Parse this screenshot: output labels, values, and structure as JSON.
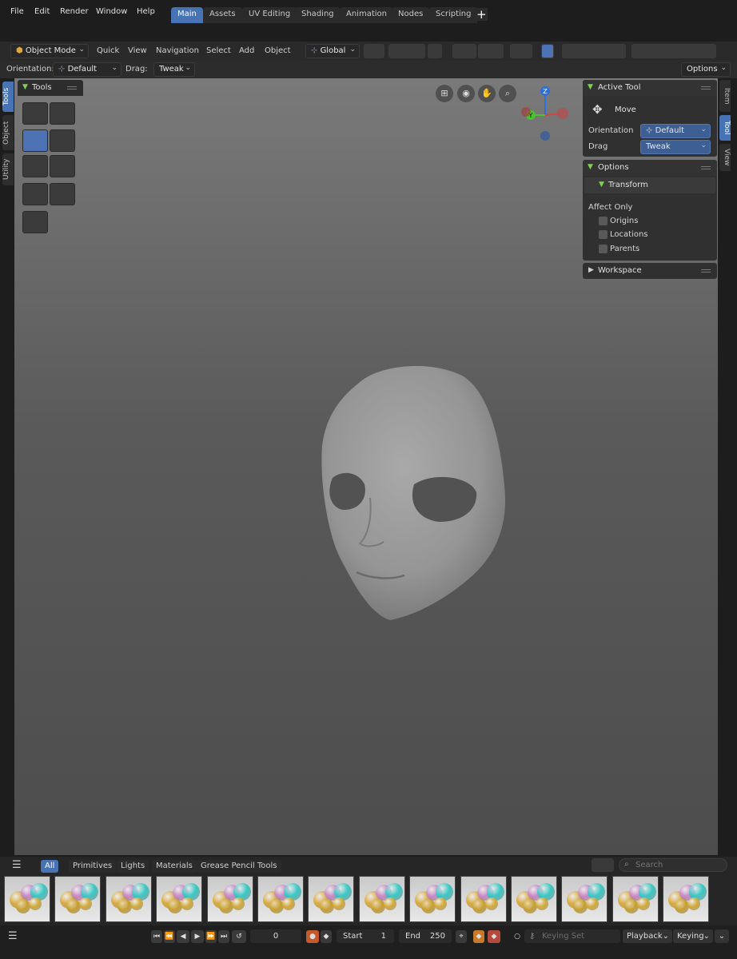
{
  "menu": [
    "File",
    "Edit",
    "Render",
    "Window",
    "Help"
  ],
  "workspaces": [
    "Main",
    "Assets",
    "UV Editing",
    "Shading",
    "Animation",
    "Nodes",
    "Scripting"
  ],
  "add_workspace": "+",
  "header": {
    "mode": "Object Mode",
    "menus": [
      "Quick",
      "View",
      "Navigation",
      "Select",
      "Add",
      "Object"
    ],
    "transform_orientation": "Global",
    "options": "Options"
  },
  "tool_settings": {
    "orientation_label": "Orientation:",
    "orientation_value": "Default",
    "drag_label": "Drag:",
    "drag_value": "Tweak"
  },
  "left_tabs": [
    "Tools",
    "Object",
    "Utility"
  ],
  "right_tabs": [
    "Item",
    "Tool",
    "View"
  ],
  "tools_panel": {
    "title": "Tools"
  },
  "gizmo": {
    "z": "Z",
    "y": "Y"
  },
  "active_tool_panel": {
    "title": "Active Tool",
    "tool_name": "Move",
    "orientation_label": "Orientation",
    "orientation_value": "Default",
    "drag_label": "Drag",
    "drag_value": "Tweak"
  },
  "options_panel": {
    "title": "Options",
    "transform_label": "Transform",
    "affect_only_label": "Affect Only",
    "checkboxes": [
      "Origins",
      "Locations",
      "Parents"
    ]
  },
  "workspace_panel": {
    "title": "Workspace"
  },
  "asset_browser": {
    "tabs": [
      "All",
      "Primitives",
      "Lights",
      "Materials",
      "Grease Pencil Tools"
    ],
    "search_placeholder": "Search"
  },
  "timeline": {
    "current_frame": "0",
    "start_label": "Start",
    "start_value": "1",
    "end_label": "End",
    "end_value": "250",
    "keying_set_placeholder": "Keying Set",
    "playback": "Playback",
    "keying": "Keying"
  },
  "colors": {
    "accent": "#4772b3",
    "axis_z": "#2f6fd6",
    "axis_y": "#4bc32e",
    "axis_x": "#d44343"
  }
}
